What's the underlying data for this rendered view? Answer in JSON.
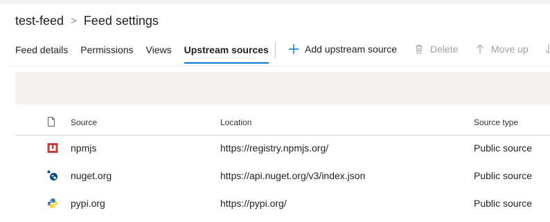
{
  "breadcrumb": {
    "feed": "test-feed",
    "separator": ">",
    "page": "Feed settings"
  },
  "tabs": [
    {
      "label": "Feed details",
      "active": false
    },
    {
      "label": "Permissions",
      "active": false
    },
    {
      "label": "Views",
      "active": false
    },
    {
      "label": "Upstream sources",
      "active": true
    }
  ],
  "toolbar": {
    "add_label": "Add upstream source",
    "delete_label": "Delete",
    "move_up_label": "Move up"
  },
  "table": {
    "columns": {
      "source": "Source",
      "location": "Location",
      "type": "Source type"
    },
    "rows": [
      {
        "name": "npmjs",
        "location": "https://registry.npmjs.org/",
        "type": "Public source",
        "icon": "npm-icon"
      },
      {
        "name": "nuget.org",
        "location": "https://api.nuget.org/v3/index.json",
        "type": "Public source",
        "icon": "nuget-icon"
      },
      {
        "name": "pypi.org",
        "location": "https://pypi.org/",
        "type": "Public source",
        "icon": "python-icon"
      }
    ]
  },
  "colors": {
    "accent": "#0078d4",
    "npm": "#cb3837",
    "nuget": "#004880",
    "python_blue": "#3776ab",
    "python_yellow": "#ffd43b"
  }
}
